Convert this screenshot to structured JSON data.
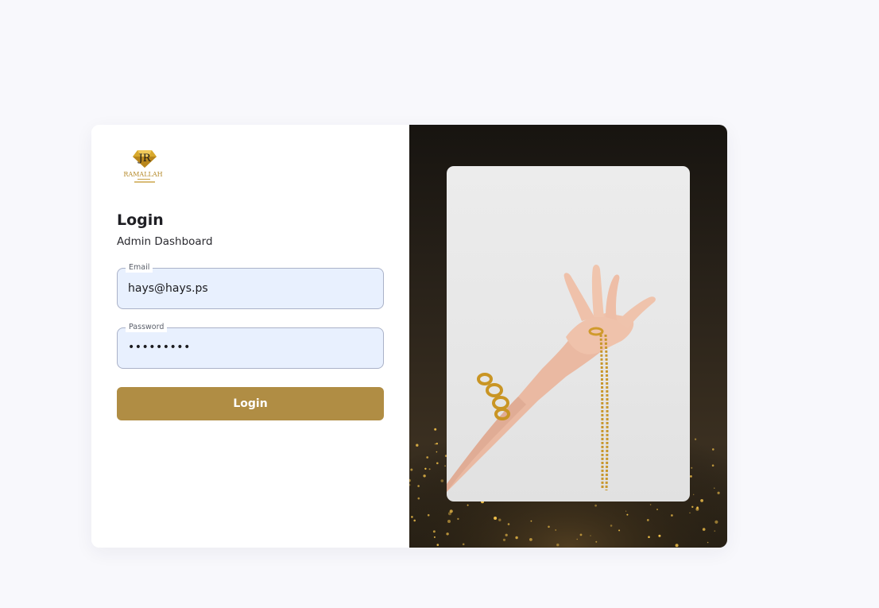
{
  "brand": {
    "logo_alt": "RAMALLAH",
    "logo_text": "RAMALLAH",
    "icon": "diamond-logo-icon"
  },
  "login": {
    "title": "Login",
    "subtitle": "Admin Dashboard",
    "email_label": "Email",
    "email_value": "hays@hays.ps",
    "password_label": "Password",
    "password_value": "•••••••••",
    "button_label": "Login"
  },
  "colors": {
    "accent": "#b08d44",
    "input_bg": "#e8f0fe",
    "page_bg": "#f8f8fc"
  },
  "hero": {
    "image_icon": "hand-with-gold-jewelry-image"
  }
}
